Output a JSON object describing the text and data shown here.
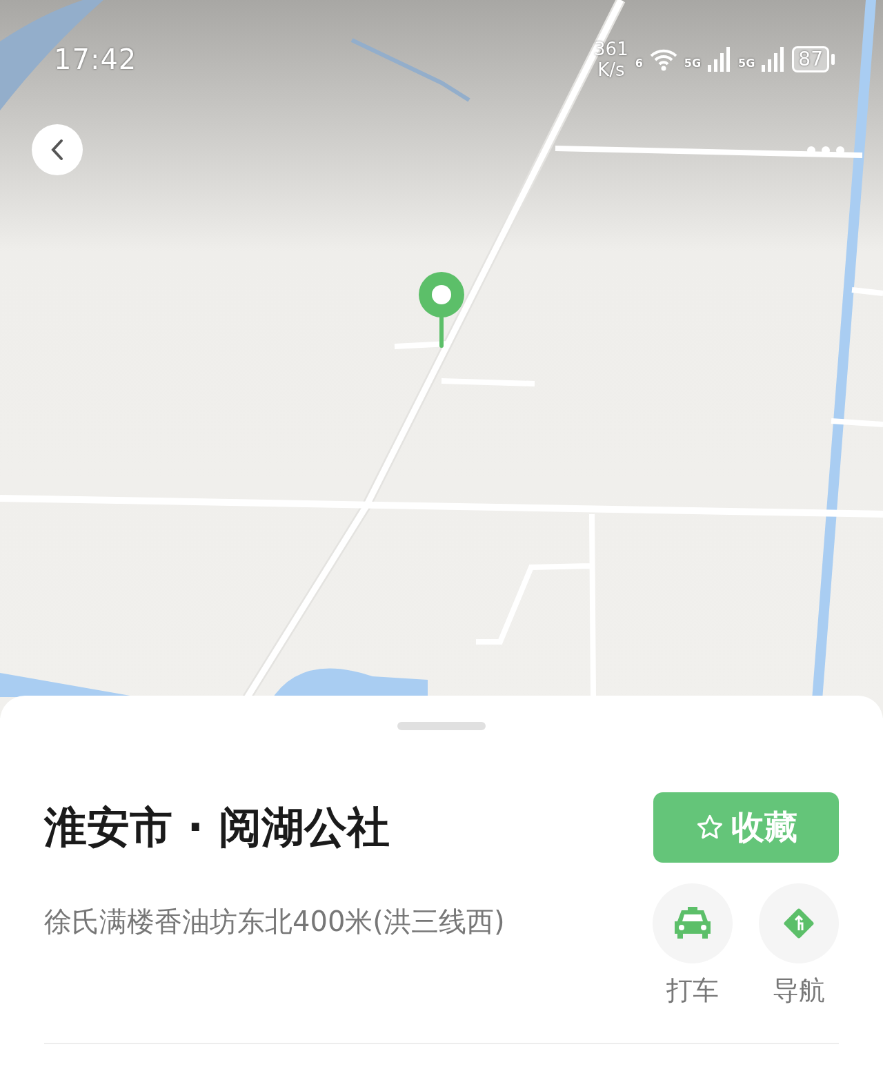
{
  "status_bar": {
    "time": "17:42",
    "speed_value": "361",
    "speed_unit": "K/s",
    "wifi_tag": "6",
    "sim1_tag": "5G",
    "sim2_tag": "5G",
    "battery": "87"
  },
  "sheet": {
    "title": "淮安市 · 阅湖公社",
    "favorite_button": "收藏",
    "address": "徐氏满楼香油坊东北400米(洪三线西)",
    "actions": [
      {
        "kind": "taxi",
        "label": "打车"
      },
      {
        "kind": "navigate",
        "label": "导航"
      }
    ]
  }
}
